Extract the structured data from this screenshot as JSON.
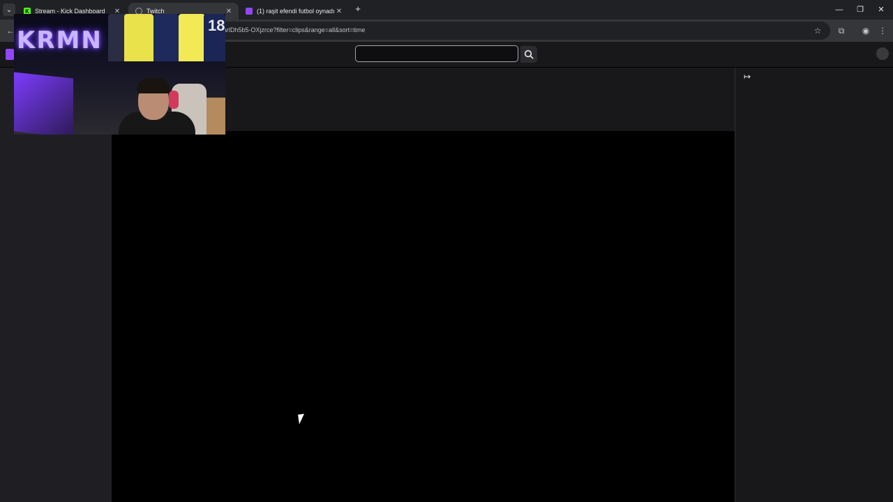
{
  "browser": {
    "tabs": [
      {
        "title": "Stream - Kick Dashboard",
        "favicon": "kick-icon",
        "favicon_glyph": "K",
        "close": "✕"
      },
      {
        "title": "Twitch",
        "favicon": "globe-icon",
        "close": "✕"
      },
      {
        "title": "(1) raşit efendi futbol oynadığı",
        "favicon": "twitch-icon",
        "close": "✕"
      }
    ],
    "active_tab": 1,
    "tab_search_glyph": "⌄",
    "new_tab_glyph": "+",
    "window_controls": {
      "minimize": "—",
      "restore": "❐",
      "close": "✕"
    },
    "url": "arlDh5b5-OXjzrce?filter=clips&range=all&sort=time",
    "toolbar_icons": {
      "bookmark": "☆",
      "extensions": "⧉",
      "profile": "◉",
      "menu": "⋮",
      "back": "←"
    }
  },
  "twitch": {
    "search": {
      "placeholder": ""
    },
    "collapse_glyph": "↦",
    "brand_color": "#9146ff"
  },
  "webcam": {
    "neon_sign": "KRMN",
    "jersey_number": "18"
  }
}
